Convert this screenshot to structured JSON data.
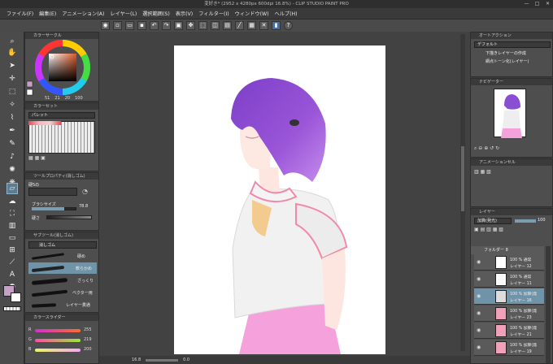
{
  "app": {
    "title": "変好き* (2952 x 4280px 600dpi 16.8%) - CLIP STUDIO PAINT PRO"
  },
  "menu": [
    "ファイル(F)",
    "編集(E)",
    "アニメーション(A)",
    "レイヤー(L)",
    "選択範囲(S)",
    "表示(V)",
    "フィルター(I)",
    "ウィンドウ(W)",
    "ヘルプ(H)"
  ],
  "window_controls": {
    "minimize": "—",
    "maximize": "□",
    "close": "✕"
  },
  "color_wheel": {
    "title": "カラーサークル",
    "values": [
      "51",
      "21",
      "20",
      "100"
    ]
  },
  "palette": {
    "title": "カラーセット",
    "name": "パレット"
  },
  "tool_property": {
    "title": "ツールプロパティ(消しゴム)",
    "tool_name": "硬5の",
    "brush_size_label": "ブラシサイズ",
    "brush_size_value": "78.8",
    "hardness_label": "硬さ"
  },
  "sub_tool": {
    "title": "サブツール(消しゴム)",
    "group": "消しゴム",
    "items": [
      "硬め",
      "軟らかめ",
      "ざっくり",
      "ベクター用",
      "レイヤー貫通"
    ]
  },
  "color_slider": {
    "title": "カラースライダー",
    "rgb": [
      {
        "label": "R",
        "value": "255"
      },
      {
        "label": "G",
        "value": "219"
      },
      {
        "label": "B",
        "value": "200"
      }
    ]
  },
  "auto_action": {
    "title": "オートアクション",
    "set": "デフォルト",
    "items": [
      "下描きレイヤーの作成",
      "網点トーン化(レイヤー)"
    ]
  },
  "navigator": {
    "title": "ナビゲーター"
  },
  "animation_cels": {
    "title": "アニメーションセル"
  },
  "layer_panel": {
    "title": "レイヤー",
    "blend_mode": "加算(発光)",
    "opacity": "100",
    "folder": "フォルダー 8",
    "layers": [
      {
        "l1": "100 % 通常",
        "l2": "レイヤー 12"
      },
      {
        "l1": "100 % 通常",
        "l2": "レイヤー 11"
      },
      {
        "l1": "100 % 加算(発",
        "l2": "レイヤー 16"
      },
      {
        "l1": "100 % 加算(発",
        "l2": "レイヤー 23"
      },
      {
        "l1": "100 % 加算(発",
        "l2": "レイヤー 21"
      },
      {
        "l1": "100 % 加算(発",
        "l2": "レイヤー 19"
      }
    ]
  },
  "status": {
    "zoom": "16.8",
    "angle": "0.0"
  },
  "colors": {
    "accent_selected": "#6f93a8",
    "main_color": "#c7a0c8",
    "canvas_bg": "#424242"
  }
}
